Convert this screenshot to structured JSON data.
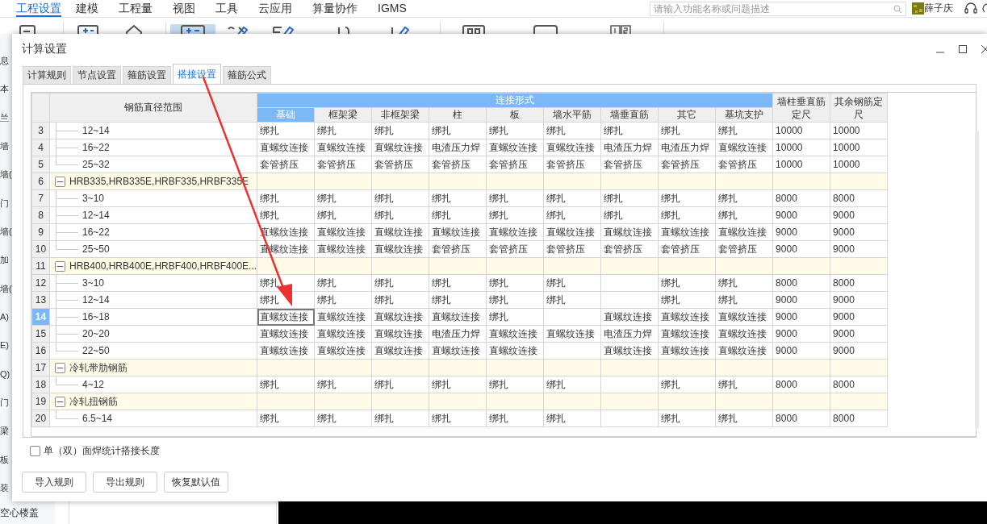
{
  "menu": {
    "items": [
      {
        "label": "工程设置",
        "selected": true
      },
      {
        "label": "建模",
        "selected": false
      },
      {
        "label": "工程量",
        "selected": false
      },
      {
        "label": "视图",
        "selected": false
      },
      {
        "label": "工具",
        "selected": false
      },
      {
        "label": "云应用",
        "selected": false
      },
      {
        "label": "算量协作",
        "selected": false
      },
      {
        "label": "IGMS",
        "selected": false
      }
    ],
    "search": {
      "placeholder": "请输入功能名称或问题描述"
    },
    "user": "薛子庆"
  },
  "sidebar": {
    "items": [
      "息",
      "本",
      "兰",
      "墙",
      "墙(",
      "门",
      "墙(",
      "加",
      "墙(",
      "A)",
      "E)",
      "Q)",
      "门",
      "梁",
      "板",
      "装"
    ],
    "footer": "空心楼盖"
  },
  "dialog": {
    "title": "计算设置",
    "tabs": [
      {
        "label": "计算规则",
        "selected": false
      },
      {
        "label": "节点设置",
        "selected": false
      },
      {
        "label": "箍筋设置",
        "selected": false
      },
      {
        "label": "搭接设置",
        "selected": true
      },
      {
        "label": "箍筋公式",
        "selected": false
      }
    ],
    "table": {
      "range_header": "钢筋直径范围",
      "group_header": "连接形式",
      "columns": [
        {
          "label": "基础",
          "selected": true
        },
        {
          "label": "框架梁",
          "selected": false
        },
        {
          "label": "非框架梁",
          "selected": false
        },
        {
          "label": "柱",
          "selected": false
        },
        {
          "label": "板",
          "selected": false
        },
        {
          "label": "墙水平筋",
          "selected": false
        },
        {
          "label": "墙垂直筋",
          "selected": false
        },
        {
          "label": "其它",
          "selected": false
        },
        {
          "label": "基坑支护",
          "selected": false
        }
      ],
      "extra_columns": [
        "墙柱垂直筋定尺",
        "其余钢筋定尺"
      ],
      "rows": [
        {
          "number": "3",
          "kind": "item",
          "range": "12~14",
          "selected": false,
          "cells": [
            "绑扎",
            "绑扎",
            "绑扎",
            "绑扎",
            "绑扎",
            "绑扎",
            "绑扎",
            "绑扎",
            "绑扎",
            "10000",
            "10000"
          ]
        },
        {
          "number": "4",
          "kind": "item",
          "range": "16~22",
          "selected": false,
          "cells": [
            "直螺纹连接",
            "直螺纹连接",
            "直螺纹连接",
            "电渣压力焊",
            "直螺纹连接",
            "直螺纹连接",
            "电渣压力焊",
            "电渣压力焊",
            "直螺纹连接",
            "10000",
            "10000"
          ]
        },
        {
          "number": "5",
          "kind": "item",
          "range": "25~32",
          "selected": false,
          "cells": [
            "套管挤压",
            "套管挤压",
            "套管挤压",
            "套管挤压",
            "套管挤压",
            "套管挤压",
            "套管挤压",
            "套管挤压",
            "套管挤压",
            "10000",
            "10000"
          ]
        },
        {
          "number": "6",
          "kind": "group",
          "label": "HRB335,HRB335E,HRBF335,HRBF335E",
          "expanded": true,
          "selected": false
        },
        {
          "number": "7",
          "kind": "item",
          "range": "3~10",
          "selected": false,
          "cells": [
            "绑扎",
            "绑扎",
            "绑扎",
            "绑扎",
            "绑扎",
            "绑扎",
            "绑扎",
            "绑扎",
            "绑扎",
            "8000",
            "8000"
          ]
        },
        {
          "number": "8",
          "kind": "item",
          "range": "12~14",
          "selected": false,
          "cells": [
            "绑扎",
            "绑扎",
            "绑扎",
            "绑扎",
            "绑扎",
            "绑扎",
            "绑扎",
            "绑扎",
            "绑扎",
            "9000",
            "9000"
          ]
        },
        {
          "number": "9",
          "kind": "item",
          "range": "16~22",
          "selected": false,
          "cells": [
            "直螺纹连接",
            "直螺纹连接",
            "直螺纹连接",
            "直螺纹连接",
            "直螺纹连接",
            "直螺纹连接",
            "直螺纹连接",
            "直螺纹连接",
            "直螺纹连接",
            "9000",
            "9000"
          ]
        },
        {
          "number": "10",
          "kind": "item",
          "range": "25~50",
          "selected": false,
          "cells": [
            "直螺纹连接",
            "直螺纹连接",
            "直螺纹连接",
            "套管挤压",
            "套管挤压",
            "套管挤压",
            "套管挤压",
            "套管挤压",
            "套管挤压",
            "9000",
            "9000"
          ]
        },
        {
          "number": "11",
          "kind": "group",
          "label": "HRB400,HRB400E,HRBF400,HRBF400E...",
          "expanded": true,
          "selected": false
        },
        {
          "number": "12",
          "kind": "item",
          "range": "3~10",
          "selected": false,
          "cells": [
            "绑扎",
            "绑扎",
            "绑扎",
            "绑扎",
            "绑扎",
            "绑扎",
            null,
            "绑扎",
            "绑扎",
            "8000",
            "8000"
          ]
        },
        {
          "number": "13",
          "kind": "item",
          "range": "12~14",
          "selected": false,
          "cells": [
            "绑扎",
            "绑扎",
            "绑扎",
            "绑扎",
            "绑扎",
            "绑扎",
            null,
            "绑扎",
            "绑扎",
            "9000",
            "9000"
          ]
        },
        {
          "number": "14",
          "kind": "item",
          "range": "16~18",
          "selected": true,
          "cells": [
            "直螺纹连接",
            "直螺纹连接",
            "直螺纹连接",
            "直螺纹连接",
            "绑扎",
            null,
            "直螺纹连接",
            "直螺纹连接",
            "直螺纹连接",
            "9000",
            "9000"
          ]
        },
        {
          "number": "15",
          "kind": "item",
          "range": "20~20",
          "selected": false,
          "cells": [
            "直螺纹连接",
            "直螺纹连接",
            "直螺纹连接",
            "电渣压力焊",
            "直螺纹连接",
            "直螺纹连接",
            "电渣压力焊",
            "直螺纹连接",
            "直螺纹连接",
            "9000",
            "9000"
          ]
        },
        {
          "number": "16",
          "kind": "item",
          "range": "22~50",
          "selected": false,
          "cells": [
            "直螺纹连接",
            "直螺纹连接",
            "直螺纹连接",
            "直螺纹连接",
            "直螺纹连接",
            null,
            "直螺纹连接",
            "直螺纹连接",
            "直螺纹连接",
            "9000",
            "9000"
          ]
        },
        {
          "number": "17",
          "kind": "group",
          "label": "冷轧带肋钢筋",
          "expanded": true,
          "selected": false
        },
        {
          "number": "18",
          "kind": "item",
          "range": "4~12",
          "selected": false,
          "cells": [
            "绑扎",
            "绑扎",
            "绑扎",
            "绑扎",
            "绑扎",
            "绑扎",
            null,
            "绑扎",
            "绑扎",
            "8000",
            "8000"
          ]
        },
        {
          "number": "19",
          "kind": "group",
          "label": "冷轧扭钢筋",
          "expanded": true,
          "selected": false
        },
        {
          "number": "20",
          "kind": "item",
          "range": "6.5~14",
          "selected": false,
          "cells": [
            "绑扎",
            "绑扎",
            "绑扎",
            "绑扎",
            "绑扎",
            "绑扎",
            null,
            "绑扎",
            "绑扎",
            "8000",
            "8000"
          ]
        }
      ]
    },
    "option": {
      "label": "单（双）面焊统计搭接长度",
      "checked": false
    },
    "buttons": [
      "导入规则",
      "导出规则",
      "恢复默认值"
    ]
  }
}
